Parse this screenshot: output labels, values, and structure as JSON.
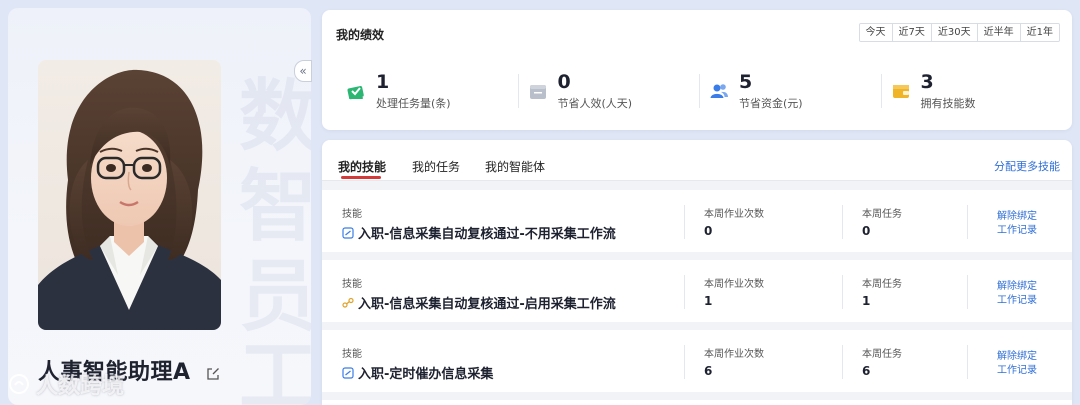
{
  "profile": {
    "agent_name": "人事智能助理A",
    "background_glyphs": [
      "数",
      "智",
      "员",
      "工"
    ],
    "watermark": "人数跨境"
  },
  "performance": {
    "title": "我的绩效",
    "ranges": [
      "今天",
      "近7天",
      "近30天",
      "近半年",
      "近1年"
    ],
    "stats": [
      {
        "value": "1",
        "label": "处理任务量(条)",
        "icon": "task-check-icon",
        "color": "#2bb673"
      },
      {
        "value": "0",
        "label": "节省人效(人天)",
        "icon": "folder-icon",
        "color": "#b9c0cc"
      },
      {
        "value": "5",
        "label": "节省资金(元)",
        "icon": "users-icon",
        "color": "#3a7de8"
      },
      {
        "value": "3",
        "label": "拥有技能数",
        "icon": "wallet-icon",
        "color": "#f0b429"
      }
    ]
  },
  "skills": {
    "tabs": [
      "我的技能",
      "我的任务",
      "我的智能体"
    ],
    "more_link": "分配更多技能",
    "col_kind": "技能",
    "col_runs": "本周作业次数",
    "col_tasks": "本周任务",
    "action_unbind": "解除绑定",
    "action_log": "工作记录",
    "rows": [
      {
        "name": "入职-信息采集自动复核通过-不用采集工作流",
        "runs": "0",
        "tasks": "0",
        "icon": "flow-icon"
      },
      {
        "name": "入职-信息采集自动复核通过-启用采集工作流",
        "runs": "1",
        "tasks": "1",
        "icon": "node-icon"
      },
      {
        "name": "入职-定时催办信息采集",
        "runs": "6",
        "tasks": "6",
        "icon": "flow-icon"
      }
    ]
  }
}
